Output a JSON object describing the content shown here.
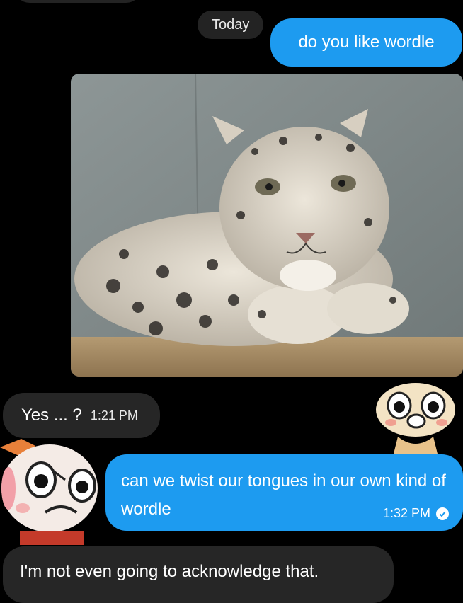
{
  "chat": {
    "date_divider": "Today",
    "messages": [
      {
        "id": "m1",
        "direction": "outgoing",
        "text": "do you like wordle"
      },
      {
        "id": "m2",
        "direction": "outgoing",
        "type": "image",
        "image": "snow-leopard-photo"
      },
      {
        "id": "m3",
        "direction": "incoming",
        "text": "Yes ... ?",
        "time": "1:21 PM"
      },
      {
        "id": "m4",
        "direction": "outgoing",
        "text": "can we twist our tongues in our own kind of wordle",
        "time": "1:32 PM",
        "status_icon": "read-check-icon"
      },
      {
        "id": "m5",
        "direction": "incoming",
        "text": "I'm not even going to acknowledge that."
      }
    ],
    "reactions": [
      {
        "id": "r1",
        "on": "m3",
        "sticker": "laughing-cartoon-sticker"
      },
      {
        "id": "r2",
        "on": "m4",
        "sticker": "angry-cartoon-sticker"
      }
    ]
  },
  "colors": {
    "background": "#000000",
    "outgoing_bubble": "#1d9bf0",
    "incoming_bubble": "#262626"
  }
}
